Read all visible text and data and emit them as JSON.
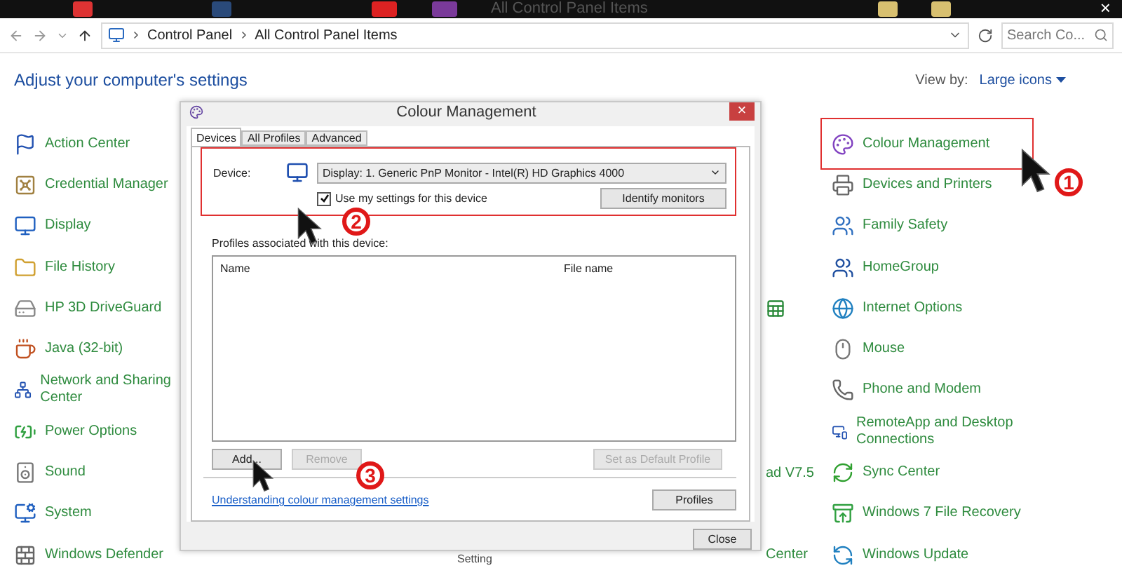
{
  "window": {
    "title": "All Control Panel Items",
    "close": "×"
  },
  "address_bar": {
    "path": [
      "Control Panel",
      "All Control Panel Items"
    ],
    "search_placeholder": "Search Co..."
  },
  "header": {
    "title": "Adjust your computer's settings",
    "view_by_label": "View by:",
    "view_by_value": "Large icons"
  },
  "left_items": [
    {
      "label": "Action Center"
    },
    {
      "label": "Credential Manager"
    },
    {
      "label": "Display"
    },
    {
      "label": "File History"
    },
    {
      "label": "HP 3D DriveGuard"
    },
    {
      "label": "Java (32-bit)"
    },
    {
      "label": "Network and Sharing Center"
    },
    {
      "label": "Power Options"
    },
    {
      "label": "Sound"
    },
    {
      "label": "System"
    },
    {
      "label": "Windows Defender"
    }
  ],
  "covered_fragments": [
    {
      "kind": "empty"
    },
    {
      "kind": "empty"
    },
    {
      "kind": "empty"
    },
    {
      "kind": "empty"
    },
    {
      "kind": "icon"
    },
    {
      "kind": "empty"
    },
    {
      "kind": "empty"
    },
    {
      "kind": "empty"
    },
    {
      "kind": "text",
      "label": "ad V7.5"
    },
    {
      "kind": "empty"
    },
    {
      "kind": "text",
      "label": "Center"
    }
  ],
  "covered_bottom_text": "Setting",
  "right_items": [
    {
      "label": "Colour Management",
      "highlighted": true
    },
    {
      "label": "Devices and Printers",
      "highlighted": false
    },
    {
      "label": "Family Safety",
      "highlighted": false
    },
    {
      "label": "HomeGroup",
      "highlighted": false
    },
    {
      "label": "Internet Options",
      "highlighted": false
    },
    {
      "label": "Mouse",
      "highlighted": false
    },
    {
      "label": "Phone and Modem",
      "highlighted": false
    },
    {
      "label": "RemoteApp and Desktop Connections",
      "highlighted": false
    },
    {
      "label": "Sync Center",
      "highlighted": false
    },
    {
      "label": "Windows 7 File Recovery",
      "highlighted": false
    },
    {
      "label": "Windows Update",
      "highlighted": false
    }
  ],
  "dialog": {
    "title": "Colour Management",
    "close": "×",
    "tabs": [
      {
        "label": "Devices",
        "selected": true
      },
      {
        "label": "All Profiles",
        "selected": false
      },
      {
        "label": "Advanced",
        "selected": false
      }
    ],
    "device_section": {
      "highlighted": true,
      "label": "Device:",
      "value": "Display: 1. Generic PnP Monitor - Intel(R) HD Graphics 4000",
      "checkbox": {
        "label": "Use my settings for this device",
        "checked": true
      },
      "identify_button": "Identify monitors"
    },
    "profiles_label": "Profiles associated with this device:",
    "columns": [
      "Name",
      "File name"
    ],
    "buttons": [
      {
        "label": "Add...",
        "disabled": false
      },
      {
        "label": "Remove",
        "disabled": true
      },
      {
        "label": "Set as Default Profile",
        "disabled": true
      }
    ],
    "link": "Understanding colour management settings",
    "profiles_button": "Profiles",
    "close_button": "Close"
  },
  "annotations": [
    {
      "number": "1"
    },
    {
      "number": "2"
    },
    {
      "number": "3"
    }
  ]
}
